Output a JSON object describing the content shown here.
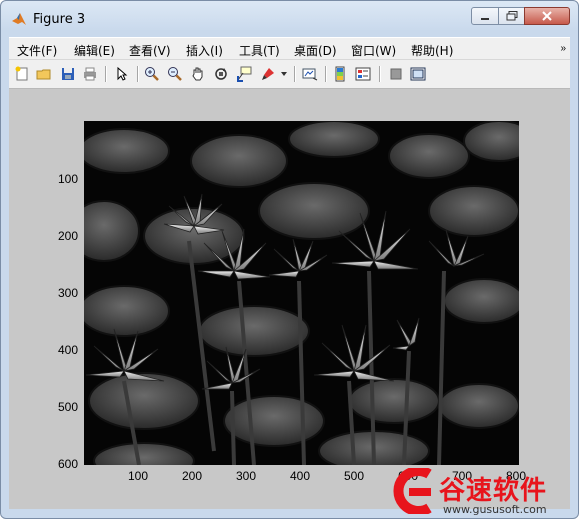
{
  "window": {
    "title": "Figure 3"
  },
  "menu": {
    "items": [
      "文件(F)",
      "编辑(E)",
      "查看(V)",
      "插入(I)",
      "工具(T)",
      "桌面(D)",
      "窗口(W)",
      "帮助(H)"
    ],
    "overflow_icon": "chevron-double-right-icon"
  },
  "toolbar": {
    "buttons": [
      "new-figure-icon",
      "open-file-icon",
      "save-icon",
      "print-icon",
      "edit-plot-arrow-icon",
      "zoom-in-icon",
      "zoom-out-icon",
      "pan-hand-icon",
      "rotate-3d-icon",
      "data-cursor-icon",
      "brush-icon",
      "brush-dropdown-icon",
      "link-plot-icon",
      "insert-colorbar-icon",
      "insert-legend-icon",
      "hide-plot-tools-icon",
      "show-plot-tools-icon"
    ]
  },
  "axes": {
    "yticks": [
      "100",
      "200",
      "300",
      "400",
      "500",
      "600"
    ],
    "xticks": [
      "100",
      "200",
      "300",
      "400",
      "500",
      "600",
      "700",
      "800"
    ]
  },
  "image": {
    "description_kind": "grayscale photo",
    "subject_colors": {
      "background": "#000000"
    }
  },
  "watermark": {
    "brand": "谷速软件",
    "url": "www.gususoft.com",
    "color": "#e8141c"
  }
}
